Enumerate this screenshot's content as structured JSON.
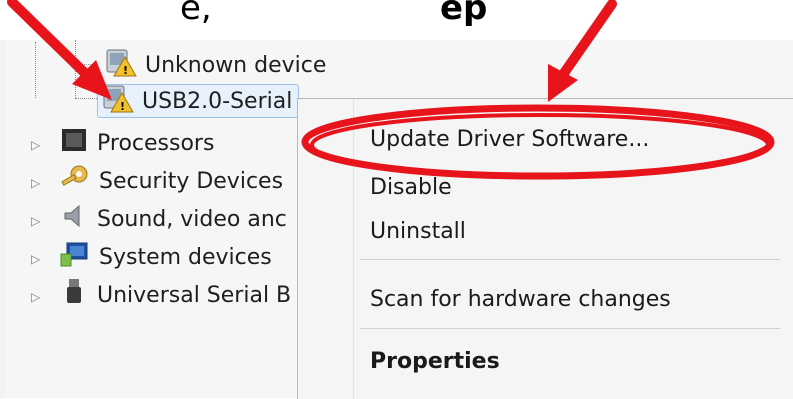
{
  "caption": {
    "left_text": "e,",
    "right_text": "ep"
  },
  "tree": {
    "items": [
      {
        "label": "Unknown device",
        "icon": "unknown-device-warning-icon"
      },
      {
        "label": "USB2.0-Serial",
        "icon": "unknown-device-warning-icon",
        "selected": true
      },
      {
        "label": "Processors",
        "icon": "processor-chip-icon"
      },
      {
        "label": "Security Devices",
        "icon": "security-key-icon"
      },
      {
        "label": "Sound, video anc",
        "icon": "speaker-icon"
      },
      {
        "label": "System devices",
        "icon": "system-computer-icon"
      },
      {
        "label": "Universal Serial B",
        "icon": "usb-plug-icon"
      }
    ]
  },
  "context_menu": {
    "items": [
      {
        "label": "Update Driver Software..."
      },
      {
        "label": "Disable"
      },
      {
        "label": "Uninstall"
      },
      {
        "label": "Scan for hardware changes"
      },
      {
        "label": "Properties",
        "bold": true
      }
    ]
  },
  "annotations": {
    "arrow_color": "#e8141c",
    "highlight_ellipse_color": "#e8141c"
  }
}
